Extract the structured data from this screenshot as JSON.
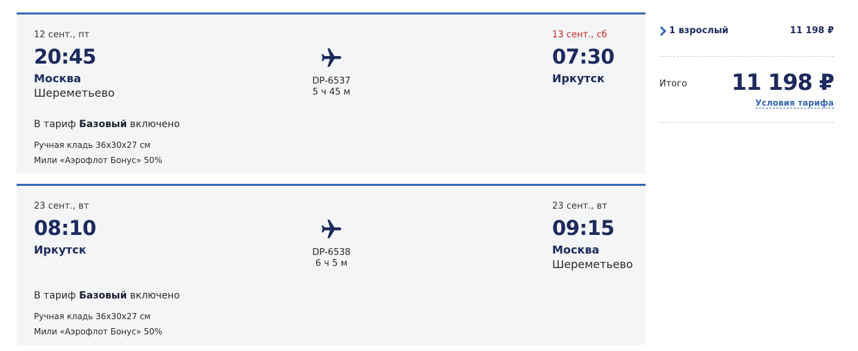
{
  "flights": [
    {
      "dep_date": "12 сент., пт",
      "dep_time": "20:45",
      "dep_city": "Москва",
      "dep_airport": "Шереметьево",
      "flight_no": "DP-6537",
      "duration": "5 ч 45 м",
      "arr_date": "13 сент., сб",
      "arr_time": "07:30",
      "arr_city": "Иркутск",
      "arr_airport": "",
      "tariff_prefix": "В тариф ",
      "tariff_name": "Базовый",
      "tariff_suffix": " включено",
      "bag": "Ручная кладь 36х30х27 см",
      "miles": "Мили «Аэрофлот Бонус» 50%"
    },
    {
      "dep_date": "23 сент., вт",
      "dep_time": "08:10",
      "dep_city": "Иркутск",
      "dep_airport": "",
      "flight_no": "DP-6538",
      "duration": "6 ч 5 м",
      "arr_date": "23 сент., вт",
      "arr_time": "09:15",
      "arr_city": "Москва",
      "arr_airport": "Шереметьево",
      "tariff_prefix": "В тариф ",
      "tariff_name": "Базовый",
      "tariff_suffix": " включено",
      "bag": "Ручная кладь 36х30х27 см",
      "miles": "Мили «Аэрофлот Бонус» 50%"
    }
  ],
  "summary": {
    "pax_label": "1 взрослый",
    "pax_price": "11 198 ₽",
    "total_label": "Итого",
    "total_price": "11 198 ₽",
    "terms_link": "Условия тарифа"
  },
  "icons": {
    "plane": "plane-icon",
    "chevron": "chevron-right-icon"
  },
  "colors": {
    "accent": "#3a69b3",
    "primary_text": "#1d2a5c",
    "next_day_date": "#c62828",
    "card_bg": "#f4f5f6"
  }
}
